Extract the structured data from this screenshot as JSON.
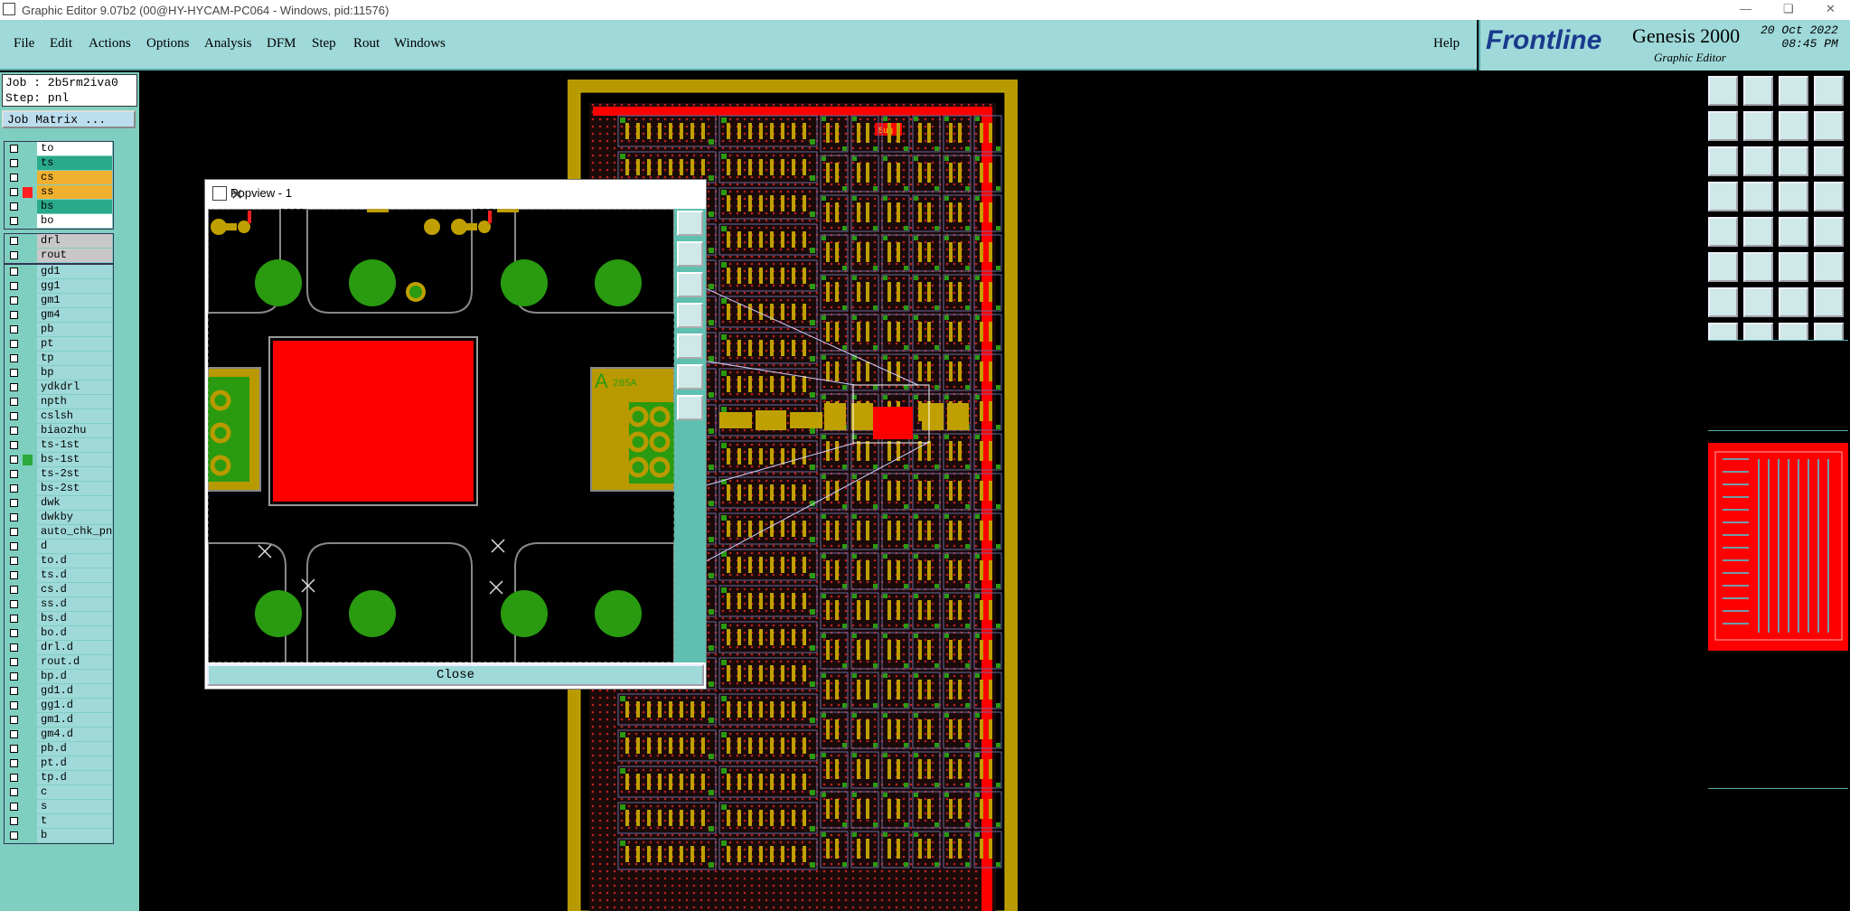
{
  "window": {
    "title": "Graphic Editor 9.07b2 (00@HY-HYCAM-PC064 - Windows, pid:11576)"
  },
  "menu": {
    "items": [
      "File",
      "Edit",
      "Actions",
      "Options",
      "Analysis",
      "DFM",
      "Step",
      "Rout",
      "Windows"
    ],
    "help": "Help"
  },
  "brand": {
    "logo": "Frontline",
    "product": "Genesis 2000",
    "subtitle": "Graphic Editor",
    "date": "20 Oct 2022",
    "time": "08:45 PM"
  },
  "job": {
    "job_label": "Job : 2b5rm2iva0",
    "step_label": "Step: pnl",
    "matrix_button": "Job Matrix ..."
  },
  "layers": {
    "group1": [
      {
        "name": "to",
        "bg": "#ffffff",
        "swatch": ""
      },
      {
        "name": "ts",
        "bg": "#2aaa8a",
        "swatch": ""
      },
      {
        "name": "cs",
        "bg": "#f0b030",
        "swatch": ""
      },
      {
        "name": "ss",
        "bg": "#f0b030",
        "swatch": "#ff2020"
      },
      {
        "name": "bs",
        "bg": "#2aaa8a",
        "swatch": ""
      },
      {
        "name": "bo",
        "bg": "#ffffff",
        "swatch": ""
      }
    ],
    "group2": [
      {
        "name": "drl",
        "bg": "#c8c8c8",
        "swatch": ""
      },
      {
        "name": "rout",
        "bg": "#c8c8c8",
        "swatch": ""
      }
    ],
    "group3": [
      {
        "name": "gd1",
        "swatch": ""
      },
      {
        "name": "gg1",
        "swatch": ""
      },
      {
        "name": "gm1",
        "swatch": ""
      },
      {
        "name": "gm4",
        "swatch": ""
      },
      {
        "name": "pb",
        "swatch": ""
      },
      {
        "name": "pt",
        "swatch": ""
      },
      {
        "name": "tp",
        "swatch": ""
      },
      {
        "name": "bp",
        "swatch": ""
      },
      {
        "name": "ydkdrl",
        "swatch": ""
      },
      {
        "name": "npth",
        "swatch": ""
      },
      {
        "name": "cslsh",
        "swatch": ""
      },
      {
        "name": "biaozhu",
        "swatch": ""
      },
      {
        "name": "ts-1st",
        "swatch": ""
      },
      {
        "name": "bs-1st",
        "swatch": "#2aaa3a"
      },
      {
        "name": "ts-2st",
        "swatch": ""
      },
      {
        "name": "bs-2st",
        "swatch": ""
      },
      {
        "name": "dwk",
        "swatch": ""
      },
      {
        "name": "dwkby",
        "swatch": ""
      },
      {
        "name": "auto_chk_pn.",
        "swatch": ""
      },
      {
        "name": "d",
        "swatch": ""
      },
      {
        "name": "to.d",
        "swatch": ""
      },
      {
        "name": "ts.d",
        "swatch": ""
      },
      {
        "name": "cs.d",
        "swatch": ""
      },
      {
        "name": "ss.d",
        "swatch": ""
      },
      {
        "name": "bs.d",
        "swatch": ""
      },
      {
        "name": "bo.d",
        "swatch": ""
      },
      {
        "name": "drl.d",
        "swatch": ""
      },
      {
        "name": "rout.d",
        "swatch": ""
      },
      {
        "name": "bp.d",
        "swatch": ""
      },
      {
        "name": "gd1.d",
        "swatch": ""
      },
      {
        "name": "gg1.d",
        "swatch": ""
      },
      {
        "name": "gm1.d",
        "swatch": ""
      },
      {
        "name": "gm4.d",
        "swatch": ""
      },
      {
        "name": "pb.d",
        "swatch": ""
      },
      {
        "name": "pt.d",
        "swatch": ""
      },
      {
        "name": "tp.d",
        "swatch": ""
      },
      {
        "name": "c",
        "swatch": ""
      },
      {
        "name": "s",
        "swatch": ""
      },
      {
        "name": "t",
        "swatch": ""
      },
      {
        "name": "b",
        "swatch": ""
      }
    ]
  },
  "popview": {
    "title": "Popview - 1",
    "close_label": "Close",
    "side_icons": [
      "zoom-icon",
      "fit-icon",
      "home-icon",
      "pan-left-icon",
      "pan-right-icon",
      "zoom-fit-icon",
      "zoom-out-icon"
    ],
    "overlay_text": "285A"
  },
  "canvas": {
    "board_label": "5ug"
  },
  "colors": {
    "panel": "#9fd9d9",
    "layer_panel": "#7fcfc0",
    "board_red": "#ff0000",
    "copper_gold": "#c0a000",
    "pad_green": "#2a9a10"
  }
}
